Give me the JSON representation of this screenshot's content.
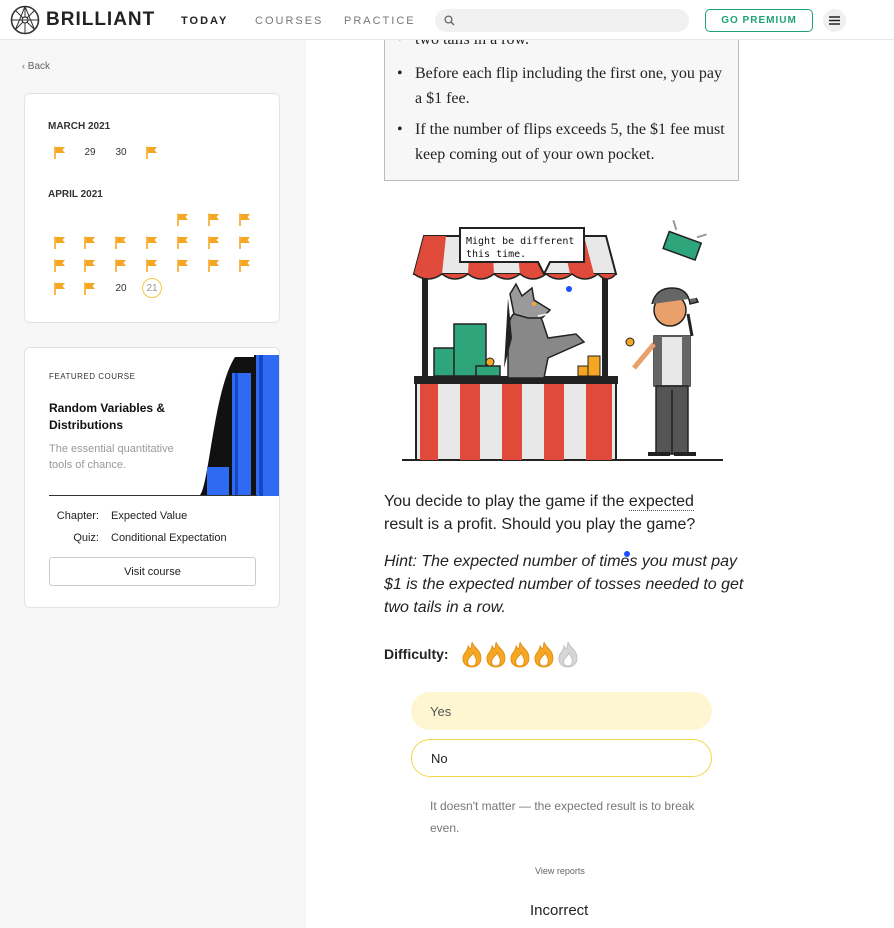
{
  "nav": {
    "brand": "BRILLIANT",
    "tabs": [
      {
        "label": "TODAY",
        "active": true
      },
      {
        "label": "COURSES",
        "active": false
      },
      {
        "label": "PRACTICE",
        "active": false
      }
    ],
    "search_placeholder": "",
    "premium_label": "GO PREMIUM",
    "icons": {
      "logo": "brilliant-logo-icon",
      "search": "search-icon",
      "menu": "hamburger-menu-icon"
    }
  },
  "sidebar": {
    "back_label": "Back",
    "calendar": {
      "months": [
        {
          "name": "MARCH 2021",
          "visible_days": [
            "29",
            "30"
          ]
        },
        {
          "name": "APRIL 2021",
          "visible_days": [
            "20",
            "21"
          ]
        }
      ],
      "today": "21",
      "streak_color": "#f5a623"
    },
    "featured": {
      "label": "FEATURED  COURSE",
      "title": "Random Variables & Distributions",
      "description": "The essential quantitative tools of chance.",
      "chapter_key": "Chapter:",
      "chapter_value": "Expected Value",
      "quiz_key": "Quiz:",
      "quiz_value": "Conditional Expectation",
      "visit_label": "Visit course"
    }
  },
  "problem": {
    "rules_partial_line": "two tails in a row.",
    "rules": [
      "Before each flip including the first one, you pay a $1 fee.",
      "If the number of flips exceeds 5, the $1 fee must keep coming out of your own pocket."
    ],
    "speech_bubble_line1": "Might be different",
    "speech_bubble_line2": "this time.",
    "question_pre": "You decide to play the game if the ",
    "question_keyword": "expected",
    "question_post": " result is a profit. Should you play the game?",
    "hint": "Hint: The expected number of times you must pay $1 is the expected number of tosses needed to get two tails in a row.",
    "difficulty_label": "Difficulty:",
    "difficulty_level": 4,
    "difficulty_max": 5,
    "answers": [
      "Yes",
      "No",
      "It doesn't matter — the expected result is to break even."
    ],
    "view_reports_label": "View reports",
    "result_label": "Incorrect"
  }
}
